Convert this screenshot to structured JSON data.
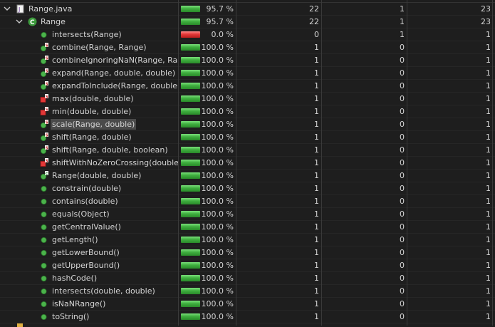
{
  "file_row": {
    "name": "Range.java",
    "coverage": "95.7 %",
    "covered": "22",
    "missed": "1",
    "total": "23"
  },
  "class_row": {
    "name": "Range",
    "coverage": "95.7 %",
    "covered": "22",
    "missed": "1",
    "total": "23"
  },
  "methods": [
    {
      "name": "intersects(Range)",
      "coverage": "0.0 %",
      "covered": "0",
      "missed": "1",
      "total": "1",
      "status": "missed",
      "icon": "method-icon"
    },
    {
      "name": "combine(Range, Range)",
      "coverage": "100.0 %",
      "covered": "1",
      "missed": "0",
      "total": "1",
      "status": "covered",
      "icon": "static-method-icon"
    },
    {
      "name": "combineIgnoringNaN(Range, Ran",
      "coverage": "100.0 %",
      "covered": "1",
      "missed": "0",
      "total": "1",
      "status": "covered",
      "icon": "static-method-icon"
    },
    {
      "name": "expand(Range, double, double)",
      "coverage": "100.0 %",
      "covered": "1",
      "missed": "0",
      "total": "1",
      "status": "covered",
      "icon": "static-method-icon"
    },
    {
      "name": "expandToInclude(Range, double)",
      "coverage": "100.0 %",
      "covered": "1",
      "missed": "0",
      "total": "1",
      "status": "covered",
      "icon": "static-method-icon"
    },
    {
      "name": "max(double, double)",
      "coverage": "100.0 %",
      "covered": "1",
      "missed": "0",
      "total": "1",
      "status": "covered",
      "icon": "private-static-method-icon"
    },
    {
      "name": "min(double, double)",
      "coverage": "100.0 %",
      "covered": "1",
      "missed": "0",
      "total": "1",
      "status": "covered",
      "icon": "private-static-method-icon"
    },
    {
      "name": "scale(Range, double)",
      "coverage": "100.0 %",
      "covered": "1",
      "missed": "0",
      "total": "1",
      "status": "covered",
      "icon": "static-method-icon",
      "selected": true
    },
    {
      "name": "shift(Range, double)",
      "coverage": "100.0 %",
      "covered": "1",
      "missed": "0",
      "total": "1",
      "status": "covered",
      "icon": "static-method-icon"
    },
    {
      "name": "shift(Range, double, boolean)",
      "coverage": "100.0 %",
      "covered": "1",
      "missed": "0",
      "total": "1",
      "status": "covered",
      "icon": "static-method-icon"
    },
    {
      "name": "shiftWithNoZeroCrossing(double,",
      "coverage": "100.0 %",
      "covered": "1",
      "missed": "0",
      "total": "1",
      "status": "covered",
      "icon": "private-static-method-icon"
    },
    {
      "name": "Range(double, double)",
      "coverage": "100.0 %",
      "covered": "1",
      "missed": "0",
      "total": "1",
      "status": "covered",
      "icon": "constructor-icon"
    },
    {
      "name": "constrain(double)",
      "coverage": "100.0 %",
      "covered": "1",
      "missed": "0",
      "total": "1",
      "status": "covered",
      "icon": "method-icon"
    },
    {
      "name": "contains(double)",
      "coverage": "100.0 %",
      "covered": "1",
      "missed": "0",
      "total": "1",
      "status": "covered",
      "icon": "method-icon"
    },
    {
      "name": "equals(Object)",
      "coverage": "100.0 %",
      "covered": "1",
      "missed": "0",
      "total": "1",
      "status": "covered",
      "icon": "method-icon"
    },
    {
      "name": "getCentralValue()",
      "coverage": "100.0 %",
      "covered": "1",
      "missed": "0",
      "total": "1",
      "status": "covered",
      "icon": "method-icon"
    },
    {
      "name": "getLength()",
      "coverage": "100.0 %",
      "covered": "1",
      "missed": "0",
      "total": "1",
      "status": "covered",
      "icon": "method-icon"
    },
    {
      "name": "getLowerBound()",
      "coverage": "100.0 %",
      "covered": "1",
      "missed": "0",
      "total": "1",
      "status": "covered",
      "icon": "method-icon"
    },
    {
      "name": "getUpperBound()",
      "coverage": "100.0 %",
      "covered": "1",
      "missed": "0",
      "total": "1",
      "status": "covered",
      "icon": "method-icon"
    },
    {
      "name": "hashCode()",
      "coverage": "100.0 %",
      "covered": "1",
      "missed": "0",
      "total": "1",
      "status": "covered",
      "icon": "method-icon"
    },
    {
      "name": "intersects(double, double)",
      "coverage": "100.0 %",
      "covered": "1",
      "missed": "0",
      "total": "1",
      "status": "covered",
      "icon": "method-icon"
    },
    {
      "name": "isNaNRange()",
      "coverage": "100.0 %",
      "covered": "1",
      "missed": "0",
      "total": "1",
      "status": "covered",
      "icon": "method-icon"
    },
    {
      "name": "toString()",
      "coverage": "100.0 %",
      "covered": "1",
      "missed": "0",
      "total": "1",
      "status": "covered",
      "icon": "method-icon"
    }
  ],
  "colors": {
    "covered_bar": "#3fae3f",
    "missed_bar": "#e33838",
    "selection": "#4a4a4a",
    "method_dot": "#4bb34b",
    "static_marker": "#e33838"
  }
}
